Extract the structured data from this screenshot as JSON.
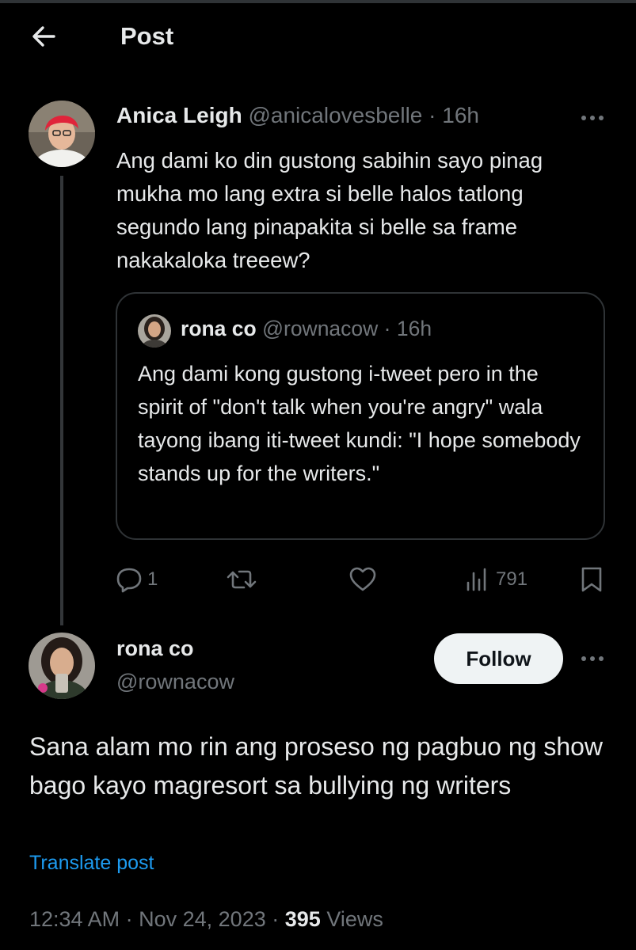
{
  "header": {
    "title": "Post"
  },
  "parent_tweet": {
    "author_name": "Anica Leigh",
    "handle": "@anicalovesbelle",
    "separator": "·",
    "time": "16h",
    "text": "Ang dami ko din gustong sabihin sayo pinag mukha mo lang extra si belle halos tatlong segundo lang pinapakita si belle sa frame nakakaloka treeew?",
    "quote": {
      "author_name": "rona co",
      "handle": "@rownacow",
      "separator": "·",
      "time": "16h",
      "text": "Ang dami kong gustong i-tweet pero in the spirit of \"don't talk when you're angry\" wala tayong ibang iti-tweet kundi: \"I hope somebody stands up for the writers.\""
    },
    "actions": {
      "reply_count": "1",
      "views_count": "791"
    }
  },
  "reply_tweet": {
    "author_name": "rona co",
    "handle": "@rownacow",
    "follow_label": "Follow",
    "text": "Sana alam mo rin ang proseso ng pagbuo ng show bago kayo magresort sa bullying ng writers",
    "translate_label": "Translate post",
    "time": "12:34 AM",
    "sep1": "·",
    "date": "Nov 24, 2023",
    "sep2": "·",
    "views": "395",
    "views_label": "Views"
  },
  "colors": {
    "background": "#000000",
    "text": "#e7e9ea",
    "muted": "#71767b",
    "link": "#1d9bf0",
    "border": "#2f3336",
    "button_bg": "#eff3f4"
  },
  "icons": [
    "back-arrow-icon",
    "more-icon",
    "reply-icon",
    "retweet-icon",
    "like-icon",
    "views-icon",
    "bookmark-icon"
  ]
}
